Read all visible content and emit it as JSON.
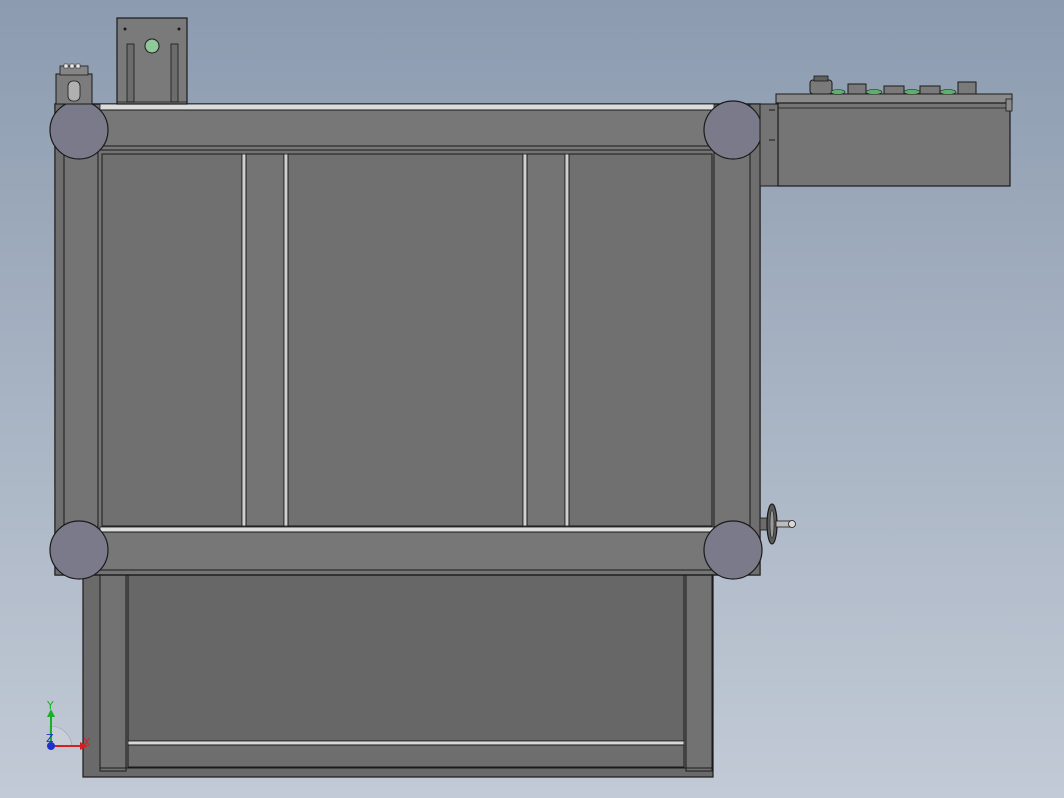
{
  "view": {
    "triad": {
      "x_label": "X",
      "y_label": "Y",
      "z_label": "Z"
    }
  },
  "colors": {
    "background_top": "#8c9bb0",
    "background_bottom": "#c2cad6",
    "frame_fill": "#767676",
    "panel_fill": "#707070",
    "lower_fill": "#666666",
    "edge": "#1a1a1a",
    "highlight": "#d8d8d8",
    "caster_fill": "#7a7a8a",
    "button_green": "#5fae6e",
    "axis_x": "#d62020",
    "axis_y": "#18b028",
    "axis_z": "#2030d0"
  }
}
